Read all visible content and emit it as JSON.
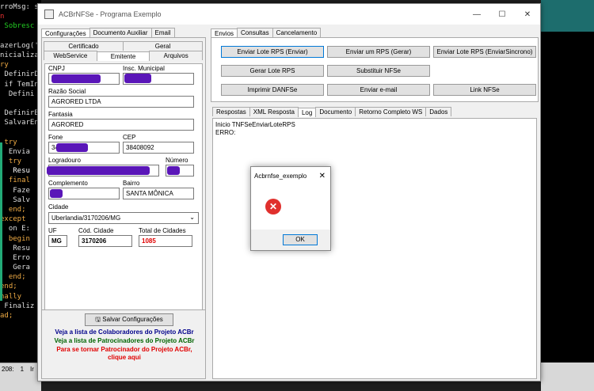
{
  "code_lines": [
    {
      "t": "rroMsg: s",
      "c": "#e0e0e0"
    },
    {
      "t": "n",
      "c": "#e33"
    },
    {
      "t": " Sobresc",
      "c": "#2c2"
    },
    {
      "t": "",
      "c": "#fff"
    },
    {
      "t": "azerLog('",
      "c": "#ddd"
    },
    {
      "t": "nicializa",
      "c": "#ddd"
    },
    {
      "t": "ry",
      "c": "#ea4"
    },
    {
      "t": " DefinirD",
      "c": "#ddd"
    },
    {
      "t": " if TemIn",
      "c": "#ddd"
    },
    {
      "t": "  Defini",
      "c": "#ddd"
    },
    {
      "t": "",
      "c": "#fff"
    },
    {
      "t": " DefinirB",
      "c": "#ddd"
    },
    {
      "t": " SalvarEn",
      "c": "#ddd"
    },
    {
      "t": "",
      "c": "#fff"
    },
    {
      "t": " try",
      "c": "#ea4"
    },
    {
      "t": "  Envia",
      "c": "#ddd"
    },
    {
      "t": "  try",
      "c": "#ea4"
    },
    {
      "t": "   Resu",
      "c": "#fff"
    },
    {
      "t": "  final",
      "c": "#ea4"
    },
    {
      "t": "   Faze",
      "c": "#ddd"
    },
    {
      "t": "   Salv",
      "c": "#ddd"
    },
    {
      "t": "  end;",
      "c": "#ea4"
    },
    {
      "t": "except",
      "c": "#ea4"
    },
    {
      "t": "  on E:",
      "c": "#ddd"
    },
    {
      "t": "  begin",
      "c": "#ea4"
    },
    {
      "t": "   Resu",
      "c": "#ddd"
    },
    {
      "t": "   Erro",
      "c": "#ddd"
    },
    {
      "t": "   Gera",
      "c": "#ddd"
    },
    {
      "t": "  end;",
      "c": "#ea4"
    },
    {
      "t": "end;",
      "c": "#ea4"
    },
    {
      "t": "nally",
      "c": "#ea4"
    },
    {
      "t": " Finaliz",
      "c": "#ddd"
    },
    {
      "t": "ad;",
      "c": "#ea4"
    }
  ],
  "statusbar": {
    "line": "208:",
    "col": "1",
    "mode": "Ir"
  },
  "window": {
    "title": "ACBrNFSe - Programa Exemplo",
    "minimize": "—",
    "maximize": "☐",
    "close": "✕"
  },
  "left_tabs": [
    "Configurações",
    "Documento Auxiliar",
    "Email"
  ],
  "sub_tabs_row1": [
    "Certificado",
    "Geral"
  ],
  "sub_tabs_row2": [
    "WebService",
    "Emitente",
    "Arquivos"
  ],
  "form": {
    "cnpj_label": "CNPJ",
    "cnpj_value": "",
    "im_label": "Insc. Municipal",
    "im_value": "",
    "razao_label": "Razão Social",
    "razao_value": "AGRORED LTDA",
    "fantasia_label": "Fantasia",
    "fantasia_value": "AGRORED",
    "fone_label": "Fone",
    "fone_value": "34",
    "cep_label": "CEP",
    "cep_value": "38408092",
    "logradouro_label": "Logradouro",
    "logradouro_value": "",
    "numero_label": "Número",
    "numero_value": "",
    "complemento_label": "Complemento",
    "complemento_value": "",
    "bairro_label": "Bairro",
    "bairro_value": "SANTA MÔNICA",
    "cidade_label": "Cidade",
    "cidade_value": "Uberlandia/3170206/MG",
    "uf_label": "UF",
    "uf_value": "MG",
    "cod_cidade_label": "Cód. Cidade",
    "cod_cidade_value": "3170206",
    "total_cidades_label": "Total de Cidades",
    "total_cidades_value": "1085"
  },
  "save_button": "Salvar Configurações",
  "links": {
    "colaboradores": "Veja a lista de Colaboradores do Projeto ACBr",
    "patrocinadores": "Veja a lista de Patrocinadores do Projeto ACBr",
    "patrocinador_line1": "Para se tornar Patrocinador do Projeto ACBr,",
    "patrocinador_line2": "clique aqui"
  },
  "right_tabs": [
    "Envios",
    "Consultas",
    "Cancelamento"
  ],
  "action_buttons": {
    "enviar_lote": "Enviar Lote RPS (Enviar)",
    "enviar_um": "Enviar um RPS (Gerar)",
    "enviar_sincrono": "Enviar Lote RPS (EnviarSincrono)",
    "gerar_lote": "Gerar Lote RPS",
    "substituir": "Substituir NFSe",
    "imprimir": "Imprimir DANFSe",
    "email": "Enviar e-mail",
    "link": "Link NFSe"
  },
  "result_tabs": [
    "Respostas",
    "XML Resposta",
    "Log",
    "Documento",
    "Retorno Completo WS",
    "Dados"
  ],
  "log": {
    "line1": "Inicio TNFSeEnviarLoteRPS",
    "line2": "ERRO:"
  },
  "dialog": {
    "title": "Acbrnfse_exemplo",
    "close": "✕",
    "ok": "OK",
    "icon": "error-icon"
  },
  "colors": {
    "link_blue": "#00008b",
    "link_green": "#006400",
    "link_red": "#e00000",
    "redact": "#5a16b8",
    "total_red": "#e00000"
  }
}
